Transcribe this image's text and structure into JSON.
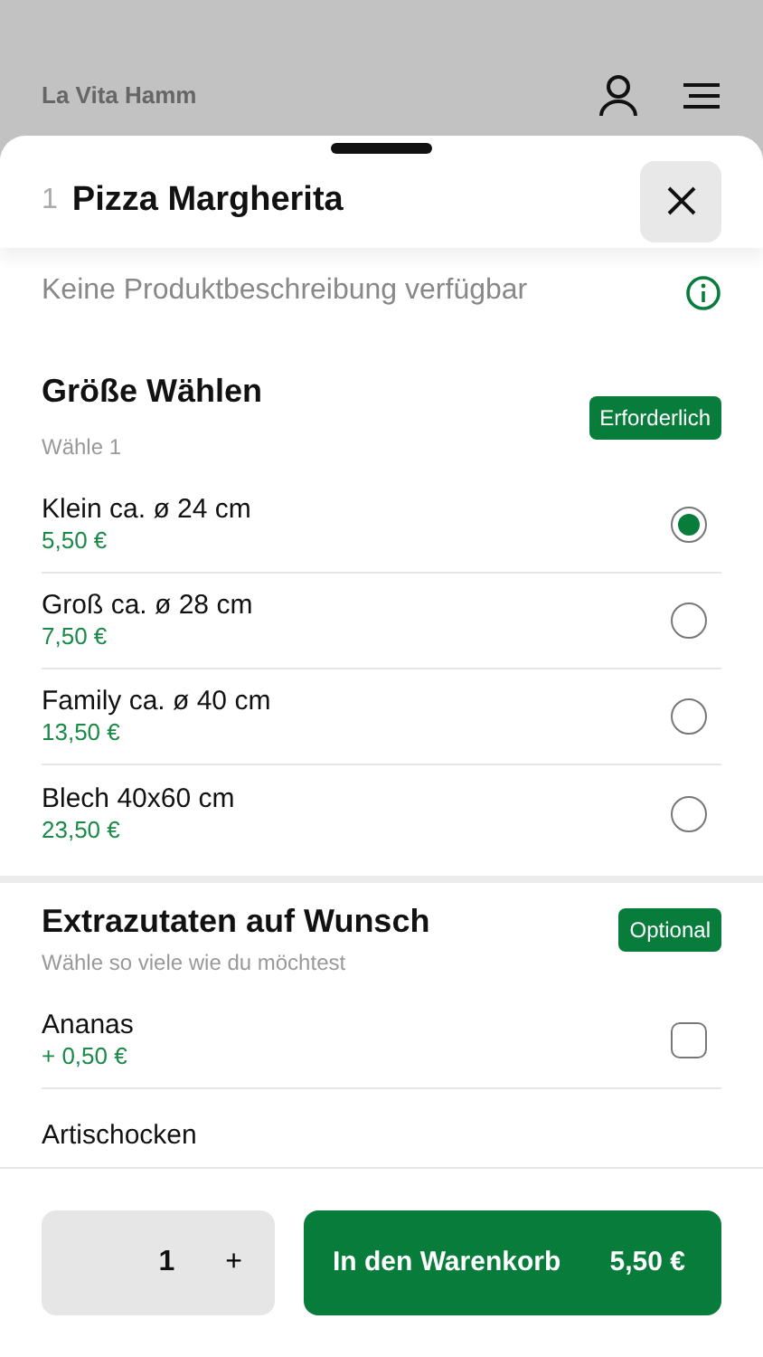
{
  "header": {
    "title": "La Vita Hamm"
  },
  "sheet": {
    "quantity_prefix": "1",
    "title": "Pizza Margherita",
    "description": "Keine Produktbeschreibung verfügbar"
  },
  "sections": [
    {
      "title": "Größe Wählen",
      "subtitle": "Wähle 1",
      "badge": "Erforderlich",
      "kind": "radio",
      "options": [
        {
          "name": "Klein ca. ø 24 cm",
          "price": "5,50 €",
          "selected": true
        },
        {
          "name": "Groß ca. ø 28 cm",
          "price": "7,50 €",
          "selected": false
        },
        {
          "name": "Family ca. ø 40 cm",
          "price": "13,50 €",
          "selected": false
        },
        {
          "name": "Blech 40x60 cm",
          "price": "23,50 €",
          "selected": false
        }
      ]
    },
    {
      "title": "Extrazutaten auf Wunsch",
      "subtitle": "Wähle so viele wie du möchtest",
      "badge": "Optional",
      "kind": "checkbox",
      "options": [
        {
          "name": "Ananas",
          "price": "+ 0,50 €",
          "checked": false
        },
        {
          "name": "Artischocken"
        }
      ]
    }
  ],
  "footer": {
    "quantity": "1",
    "plus": "+",
    "cart_label": "In den Warenkorb",
    "cart_price": "5,50 €"
  }
}
